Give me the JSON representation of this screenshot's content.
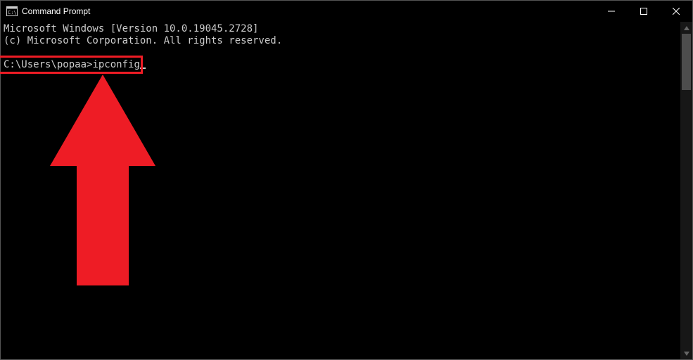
{
  "window": {
    "title": "Command Prompt"
  },
  "terminal": {
    "line1": "Microsoft Windows [Version 10.0.19045.2728]",
    "line2": "(c) Microsoft Corporation. All rights reserved.",
    "blank": "",
    "prompt": "C:\\Users\\popaa>",
    "command": "ipconfig"
  },
  "annotation": {
    "highlight_color": "#ee1c25",
    "arrow_color": "#ee1c25"
  }
}
